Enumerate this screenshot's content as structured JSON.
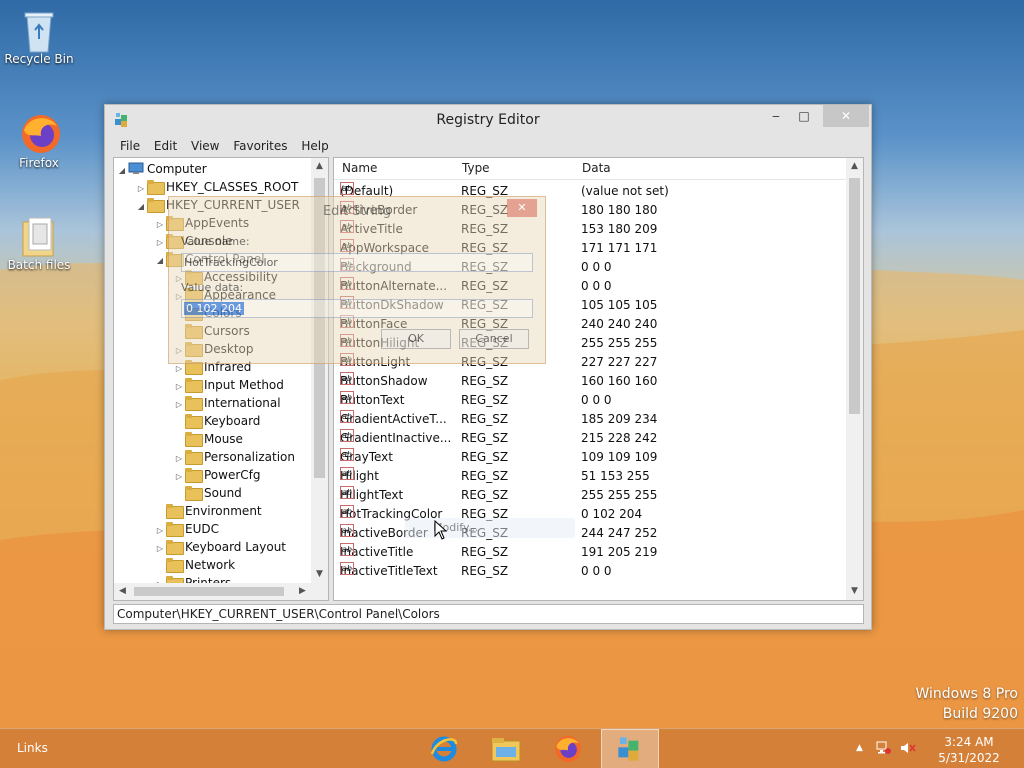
{
  "desktop": {
    "icons": [
      {
        "label": "Recycle Bin"
      },
      {
        "label": "Firefox"
      },
      {
        "label": "Batch files"
      }
    ],
    "brand_line1": "Windows 8 Pro",
    "brand_line2": "Build 9200"
  },
  "window": {
    "title": "Registry Editor",
    "controls": {
      "minimize": "‒",
      "maximize": "□",
      "close": "✕"
    },
    "menu": [
      "File",
      "Edit",
      "View",
      "Favorites",
      "Help"
    ],
    "tree": [
      {
        "label": "Computer",
        "arrow": "◢"
      },
      {
        "label": "HKEY_CLASSES_ROOT",
        "arrow": "▷"
      },
      {
        "label": "HKEY_CURRENT_USER",
        "arrow": "◢"
      },
      {
        "label": "AppEvents",
        "arrow": "▷"
      },
      {
        "label": "Console",
        "arrow": "▷"
      },
      {
        "label": "Control Panel",
        "arrow": "◢"
      },
      {
        "label": "Accessibility",
        "arrow": "▷"
      },
      {
        "label": "Appearance",
        "arrow": "▷"
      },
      {
        "label": "Colors",
        "arrow": ""
      },
      {
        "label": "Cursors",
        "arrow": ""
      },
      {
        "label": "Desktop",
        "arrow": "▷"
      },
      {
        "label": "Infrared",
        "arrow": "▷"
      },
      {
        "label": "Input Method",
        "arrow": "▷"
      },
      {
        "label": "International",
        "arrow": "▷"
      },
      {
        "label": "Keyboard",
        "arrow": ""
      },
      {
        "label": "Mouse",
        "arrow": ""
      },
      {
        "label": "Personalization",
        "arrow": "▷"
      },
      {
        "label": "PowerCfg",
        "arrow": "▷"
      },
      {
        "label": "Sound",
        "arrow": ""
      },
      {
        "label": "Environment",
        "arrow": ""
      },
      {
        "label": "EUDC",
        "arrow": "▷"
      },
      {
        "label": "Keyboard Layout",
        "arrow": "▷"
      },
      {
        "label": "Network",
        "arrow": ""
      },
      {
        "label": "Printers",
        "arrow": "▷"
      }
    ],
    "columns": {
      "name": "Name",
      "type": "Type",
      "data": "Data"
    },
    "values": [
      {
        "name": "(Default)",
        "type": "REG_SZ",
        "data": "(value not set)"
      },
      {
        "name": "ActiveBorder",
        "type": "REG_SZ",
        "data": "180 180 180"
      },
      {
        "name": "ActiveTitle",
        "type": "REG_SZ",
        "data": "153 180 209"
      },
      {
        "name": "AppWorkspace",
        "type": "REG_SZ",
        "data": "171 171 171"
      },
      {
        "name": "Background",
        "type": "REG_SZ",
        "data": "0 0 0"
      },
      {
        "name": "ButtonAlternate...",
        "type": "REG_SZ",
        "data": "0 0 0"
      },
      {
        "name": "ButtonDkShadow",
        "type": "REG_SZ",
        "data": "105 105 105"
      },
      {
        "name": "ButtonFace",
        "type": "REG_SZ",
        "data": "240 240 240"
      },
      {
        "name": "ButtonHilight",
        "type": "REG_SZ",
        "data": "255 255 255"
      },
      {
        "name": "ButtonLight",
        "type": "REG_SZ",
        "data": "227 227 227"
      },
      {
        "name": "ButtonShadow",
        "type": "REG_SZ",
        "data": "160 160 160"
      },
      {
        "name": "ButtonText",
        "type": "REG_SZ",
        "data": "0 0 0"
      },
      {
        "name": "GradientActiveT...",
        "type": "REG_SZ",
        "data": "185 209 234"
      },
      {
        "name": "GradientInactive...",
        "type": "REG_SZ",
        "data": "215 228 242"
      },
      {
        "name": "GrayText",
        "type": "REG_SZ",
        "data": "109 109 109"
      },
      {
        "name": "Hilight",
        "type": "REG_SZ",
        "data": "51 153 255"
      },
      {
        "name": "HilightText",
        "type": "REG_SZ",
        "data": "255 255 255"
      },
      {
        "name": "HotTrackingColor",
        "type": "REG_SZ",
        "data": "0 102 204"
      },
      {
        "name": "InactiveBorder",
        "type": "REG_SZ",
        "data": "244 247 252"
      },
      {
        "name": "InactiveTitle",
        "type": "REG_SZ",
        "data": "191 205 219"
      },
      {
        "name": "InactiveTitleText",
        "type": "REG_SZ",
        "data": "0 0 0"
      }
    ],
    "status_path": "Computer\\HKEY_CURRENT_USER\\Control Panel\\Colors"
  },
  "edit_dialog": {
    "title": "Edit String",
    "close": "✕",
    "value_name_label": "Value name:",
    "value_name": "HotTrackingColor",
    "value_data_label": "Value data:",
    "value_data": "0 102 204",
    "ok_label": "OK",
    "cancel_label": "Cancel"
  },
  "context_tip": "Modify...",
  "taskbar": {
    "links_label": "Links",
    "apps": [
      "internet-explorer-icon",
      "file-explorer-icon",
      "firefox-icon",
      "registry-editor-icon"
    ],
    "tray_expand": "▲",
    "time": "3:24 AM",
    "date": "5/31/2022"
  },
  "colors": {
    "accent": "#3399ff",
    "folder": "#e8c15a",
    "close": "#c7c7c7"
  }
}
